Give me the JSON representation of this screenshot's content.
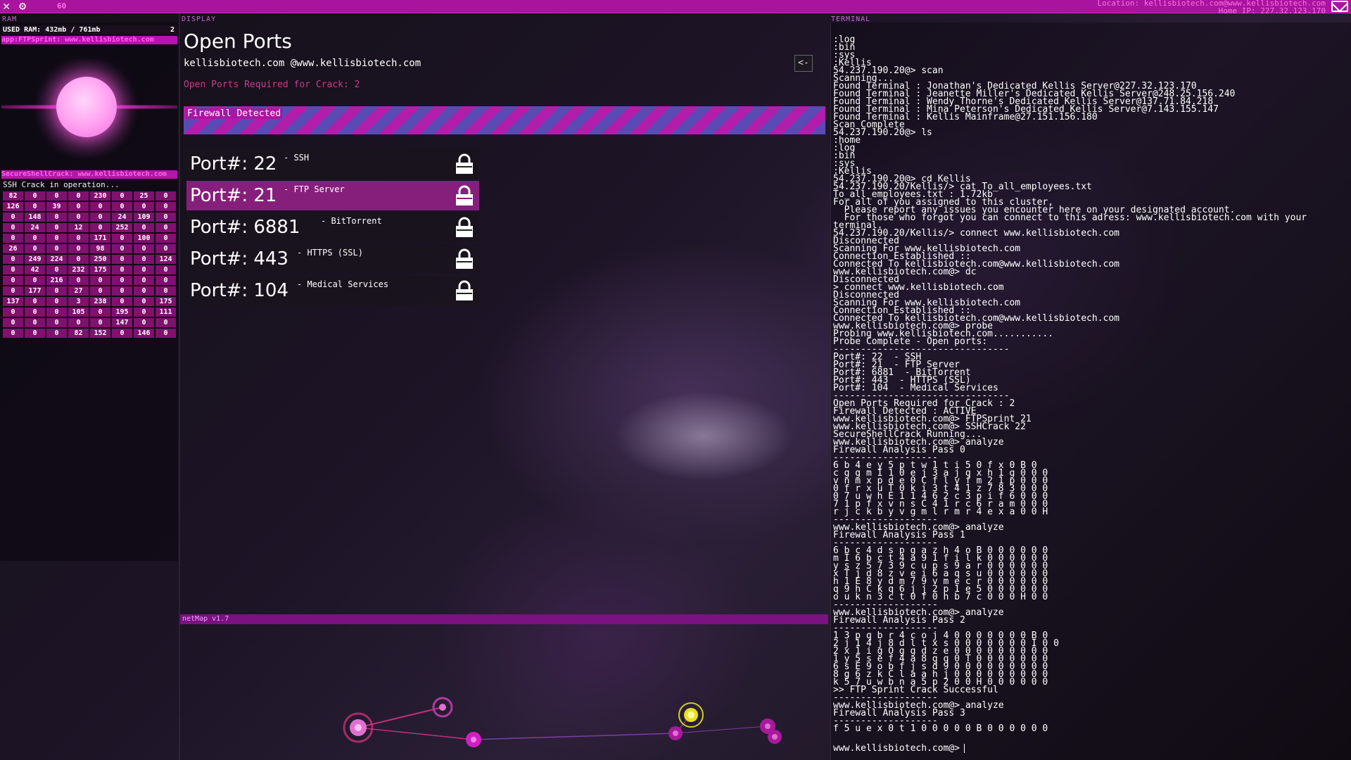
{
  "topbar": {
    "fps": "60",
    "location": "Location: kellisbiotech.com@www.kellisbiotech.com",
    "home_ip": "Home IP: 227.32.123.170",
    "close_icon": "close-icon",
    "settings_icon": "gear-icon",
    "mail_icon": "mail-icon"
  },
  "ram": {
    "label": "RAM",
    "used": "USED RAM: 432mb / 761mb",
    "count": "2",
    "app1": "app:FTPSprint: www.kellisbiotech.com",
    "app2": "SecureShellCrack: www.kellisbiotech.com",
    "crack_status": "SSH Crack in operation...",
    "grid": [
      [
        "82",
        "0",
        "0",
        "0",
        "230",
        "0",
        "25",
        "0"
      ],
      [
        "126",
        "0",
        "39",
        "0",
        "0",
        "0",
        "0",
        "0"
      ],
      [
        "0",
        "148",
        "0",
        "0",
        "0",
        "24",
        "109",
        "0"
      ],
      [
        "0",
        "24",
        "0",
        "12",
        "0",
        "252",
        "0",
        "0"
      ],
      [
        "0",
        "0",
        "0",
        "0",
        "171",
        "0",
        "100",
        "0"
      ],
      [
        "26",
        "0",
        "0",
        "0",
        "98",
        "0",
        "0",
        "0"
      ],
      [
        "0",
        "249",
        "224",
        "0",
        "250",
        "0",
        "0",
        "124"
      ],
      [
        "0",
        "42",
        "0",
        "232",
        "175",
        "0",
        "0",
        "0"
      ],
      [
        "0",
        "0",
        "216",
        "0",
        "0",
        "0",
        "0",
        "0"
      ],
      [
        "0",
        "177",
        "0",
        "27",
        "0",
        "0",
        "0",
        "0"
      ],
      [
        "137",
        "0",
        "0",
        "3",
        "238",
        "0",
        "0",
        "175"
      ],
      [
        "0",
        "0",
        "0",
        "105",
        "0",
        "195",
        "0",
        "111"
      ],
      [
        "0",
        "0",
        "0",
        "0",
        "0",
        "147",
        "0",
        "0"
      ],
      [
        "0",
        "0",
        "0",
        "82",
        "152",
        "0",
        "146",
        "0"
      ]
    ]
  },
  "display": {
    "label": "DISPLAY",
    "title": "Open Ports",
    "subtitle": "kellisbiotech.com @www.kellisbiotech.com",
    "required": "Open Ports Required for Crack: 2",
    "back_label": "<-",
    "firewall": "Firewall Detected",
    "ports": [
      {
        "num": "Port#: 22",
        "name": "- SSH"
      },
      {
        "num": "Port#: 21",
        "name": "- FTP Server"
      },
      {
        "num": "Port#: 6881",
        "name": "- BitTorrent"
      },
      {
        "num": "Port#: 443",
        "name": "- HTTPS (SSL)"
      },
      {
        "num": "Port#: 104",
        "name": "- Medical Services"
      }
    ]
  },
  "netmap": {
    "label": "netMap v1.7"
  },
  "terminal": {
    "label": "TERMINAL",
    "lines": [
      ":log",
      ":bin",
      ":sys",
      ":Kellis",
      "54.237.190.20@> scan",
      "Scanning...",
      "Found Terminal : Jonathan's Dedicated Kellis Server@227.32.123.170",
      "Found Terminal : Jeanette Miller's Dedicated Kellis Server@248.25.156.240",
      "Found Terminal : Wendy Thorne's Dedicated Kellis Server@137.71.84.218",
      "Found Terminal : Mina Peterson's Dedicated Kellis Server@7.143.155.147",
      "Found Terminal : Kellis Mainframe@27.151.156.180",
      "Scan Complete",
      "54.237.190.20@> ls",
      ":home",
      ":log",
      ":bin",
      ":sys",
      ":Kellis",
      "54.237.190.20@> cd Kellis",
      "54.237.190.20/Kellis/> cat To_all_employees.txt",
      "To_all_employees.txt : 1.72kb",
      "For all of you assigned to this cluster,",
      "  Please report any issues you encounter here on your designated account.",
      "  For those who forgot you can connect to this adress: www.kellisbiotech.com with your",
      "terminal.",
      "54.237.190.20/Kellis/> connect www.kellisbiotech.com",
      "Disconnected",
      "Scanning For www.kellisbiotech.com",
      "Connection Established ::",
      "Connected To kellisbiotech.com@www.kellisbiotech.com",
      "www.kellisbiotech.com@> dc",
      "Disconnected",
      "> connect www.kellisbiotech.com",
      "Disconnected",
      "Scanning For www.kellisbiotech.com",
      "Connection Established ::",
      "Connected To kellisbiotech.com@www.kellisbiotech.com",
      "www.kellisbiotech.com@> probe",
      "Probing www.kellisbiotech.com...........",
      "Probe Complete - Open ports:",
      "--------------------------------",
      "Port#: 22  - SSH",
      "Port#: 21  - FTP Server",
      "Port#: 6881  - BitTorrent",
      "Port#: 443  - HTTPS (SSL)",
      "Port#: 104  - Medical Services",
      "--------------------------------",
      "Open Ports Required for Crack : 2",
      "Firewall Detected : ACTIVE",
      "www.kellisbiotech.com@> FTPSprint 21",
      "www.kellisbiotech.com@> SSHCrack 22",
      "SecureShellCrack Running...",
      "www.kellisbiotech.com@> analyze",
      "Firewall Analysis Pass 0",
      "-------------------",
      "6 b 4 e y 5 p t w 1 t i 5 0 f x 0 B 0",
      "c g g m I 1 0 e j 3 a j q x h 1 g 0 0 0",
      "v n m x p d e 0 C f l y f m 2 1 p 0 0 0",
      "0 f r x u T 0 k i 3 t 4 1 z 7 8 3 0 0 0",
      "0 7 u w h E 1 1 4 6 2 c 3 p i f 6 0 0 0",
      "7 1 p f x v n s C 4 1 r c 6 r a m 0 0 0",
      "r j c k b y v g m l r m r 4 e x a 0 0 H",
      "-------------------",
      "www.kellisbiotech.com@> analyze",
      "Firewall Analysis Pass 1",
      "-------------------",
      "6 b c 4 d s p g a z h 4 o B 0 0 0 0 0 0",
      "m I 6 b c t 4 a 9 1 f i l k 0 0 0 0 0 0",
      "y s z 5 7 3 9 c u p s 9 a r 0 0 0 0 0 0",
      "x T j d 8 z v e i 6 a q s u 0 0 0 0 0 0",
      "h 1 E 8 y d m 7 9 v m e c r 0 0 0 0 0 0",
      "q 9 h C k q 6 j j 2 p 1 e 5 0 0 0 0 0 0",
      "o u k n 3 c t 0 f 0 h b 7 c 0 0 0 H 0 0",
      "-------------------",
      "www.kellisbiotech.com@> analyze",
      "Firewall Analysis Pass 2",
      "-------------------",
      "1 3 p q b r 4 c o j 4 0 0 0 0 0 0 0 B 0",
      "2 j 1 4 j 8 d l t x s 0 0 0 0 0 0 0 I 0 0",
      "2 x 1 i g O g g d z e 0 0 0 0 0 0 0 0 0",
      "1 y 5 s e f 4 a 8 g q 0 T 0 0 0 0 0 0 0",
      "6 s E 9 o b f j s d 9 0 0 0 0 0 0 0 0 0",
      "8 g 6 z k C l a a h j 0 0 0 0 0 0 0 0 0",
      "k 5 7 u w b n a 5 p 2 0 0 H 0 0 0 0 0 0",
      ">> FTP Sprint Crack Successful",
      "-------------------",
      "www.kellisbiotech.com@> analyze",
      "Firewall Analysis Pass 3",
      "-------------------",
      "f 5 u e x 0 t 1 0 0 0 0 0 B 0 0 0 0 0 0"
    ],
    "prompt": "www.kellisbiotech.com@>"
  }
}
